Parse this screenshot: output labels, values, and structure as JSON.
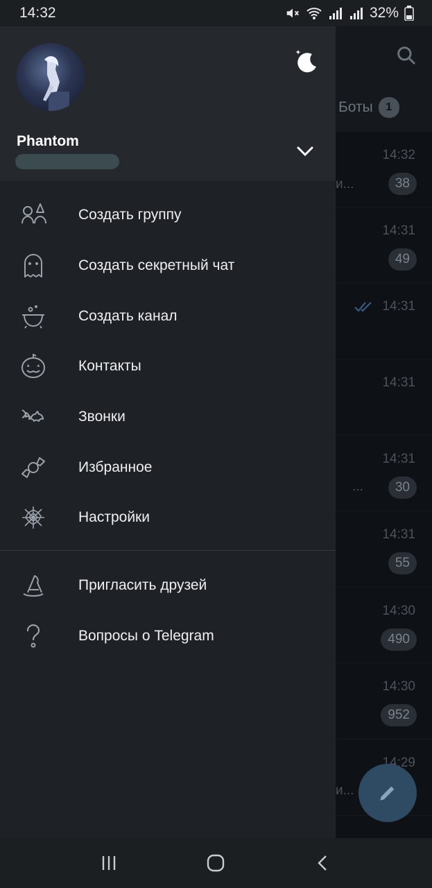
{
  "status_bar": {
    "time": "14:32",
    "battery": "32%",
    "icons": [
      "mute-icon",
      "wifi-icon",
      "signal-icon",
      "signal-icon",
      "battery-icon"
    ]
  },
  "drawer": {
    "user": {
      "name": "Phantom"
    },
    "menu": [
      {
        "label": "Создать группу",
        "icon": "group-witch-icon"
      },
      {
        "label": "Создать секретный чат",
        "icon": "ghost-icon"
      },
      {
        "label": "Создать канал",
        "icon": "cauldron-icon"
      },
      {
        "label": "Контакты",
        "icon": "pumpkin-icon"
      },
      {
        "label": "Звонки",
        "icon": "bat-icon"
      },
      {
        "label": "Избранное",
        "icon": "candy-icon"
      },
      {
        "label": "Настройки",
        "icon": "spiderweb-icon"
      }
    ],
    "menu_secondary": [
      {
        "label": "Пригласить друзей",
        "icon": "witch-hat-icon"
      },
      {
        "label": "Вопросы о Telegram",
        "icon": "question-icon"
      }
    ]
  },
  "background_chats": {
    "tab_label": "Боты",
    "tab_count": "1",
    "rows": [
      {
        "time": "14:32",
        "badge": "38",
        "preview": "и..."
      },
      {
        "time": "14:31",
        "badge": "49",
        "preview": ""
      },
      {
        "time": "14:31",
        "badge": "",
        "preview": ""
      },
      {
        "time": "14:31",
        "badge": "",
        "preview": ""
      },
      {
        "time": "14:31",
        "badge": "30",
        "preview": "..."
      },
      {
        "time": "14:31",
        "badge": "55",
        "preview": ""
      },
      {
        "time": "14:30",
        "badge": "490",
        "preview": ""
      },
      {
        "time": "14:30",
        "badge": "952",
        "preview": ""
      },
      {
        "time": "14:29",
        "badge": "",
        "preview": "и..."
      }
    ]
  },
  "colors": {
    "drawer_bg": "#1e2226",
    "drawer_header_bg": "#25292e",
    "fab": "#2f4a63"
  }
}
